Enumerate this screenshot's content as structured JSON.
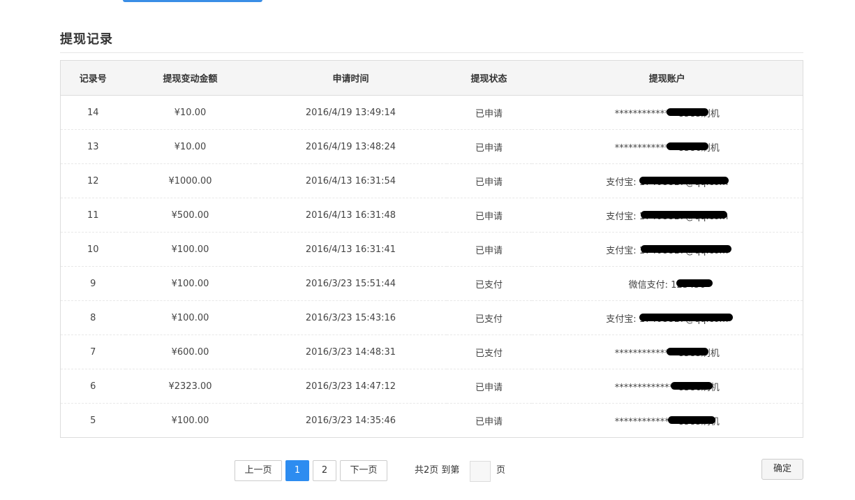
{
  "section_title": "提现记录",
  "table": {
    "headers": [
      "记录号",
      "提现变动金额",
      "申请时间",
      "提现状态",
      "提现账户"
    ],
    "rows": [
      {
        "id": "14",
        "amount": "¥10.00",
        "time": "2016/4/19 13:49:14",
        "status": "已申请",
        "account": "**************8585刷机"
      },
      {
        "id": "13",
        "amount": "¥10.00",
        "time": "2016/4/19 13:48:24",
        "status": "已申请",
        "account": "**************8386刷机"
      },
      {
        "id": "12",
        "amount": "¥1000.00",
        "time": "2016/4/13 16:31:54",
        "status": "已申请",
        "account": "支付宝: 17408817@qq.com"
      },
      {
        "id": "11",
        "amount": "¥500.00",
        "time": "2016/4/13 16:31:48",
        "status": "已申请",
        "account": "支付宝: 17408817@qq.com"
      },
      {
        "id": "10",
        "amount": "¥100.00",
        "time": "2016/4/13 16:31:41",
        "status": "已申请",
        "account": "支付宝: 17408817@qq.com"
      },
      {
        "id": "9",
        "amount": "¥100.00",
        "time": "2016/3/23 15:51:44",
        "status": "已支付",
        "account": "微信支付: 123456"
      },
      {
        "id": "8",
        "amount": "¥100.00",
        "time": "2016/3/23 15:43:16",
        "status": "已支付",
        "account": "支付宝: 17408817@qq.com"
      },
      {
        "id": "7",
        "amount": "¥600.00",
        "time": "2016/3/23 14:48:31",
        "status": "已支付",
        "account": "**************8585刷机"
      },
      {
        "id": "6",
        "amount": "¥2323.00",
        "time": "2016/3/23 14:47:12",
        "status": "已申请",
        "account": "**************8386刷机"
      },
      {
        "id": "5",
        "amount": "¥100.00",
        "time": "2016/3/23 14:35:46",
        "status": "已申请",
        "account": "**************8585刷机"
      }
    ]
  },
  "pagination": {
    "prev_label": "上一页",
    "pages": [
      "1",
      "2"
    ],
    "current_page": "1",
    "next_label": "下一页",
    "total_label": "共2页 到第",
    "jump_value": "",
    "unit_label": "页",
    "confirm_label": "确定"
  },
  "colors": {
    "accent": "#2d8cf0",
    "header_bg": "#f5f5f5",
    "border": "#dcdcdc"
  }
}
